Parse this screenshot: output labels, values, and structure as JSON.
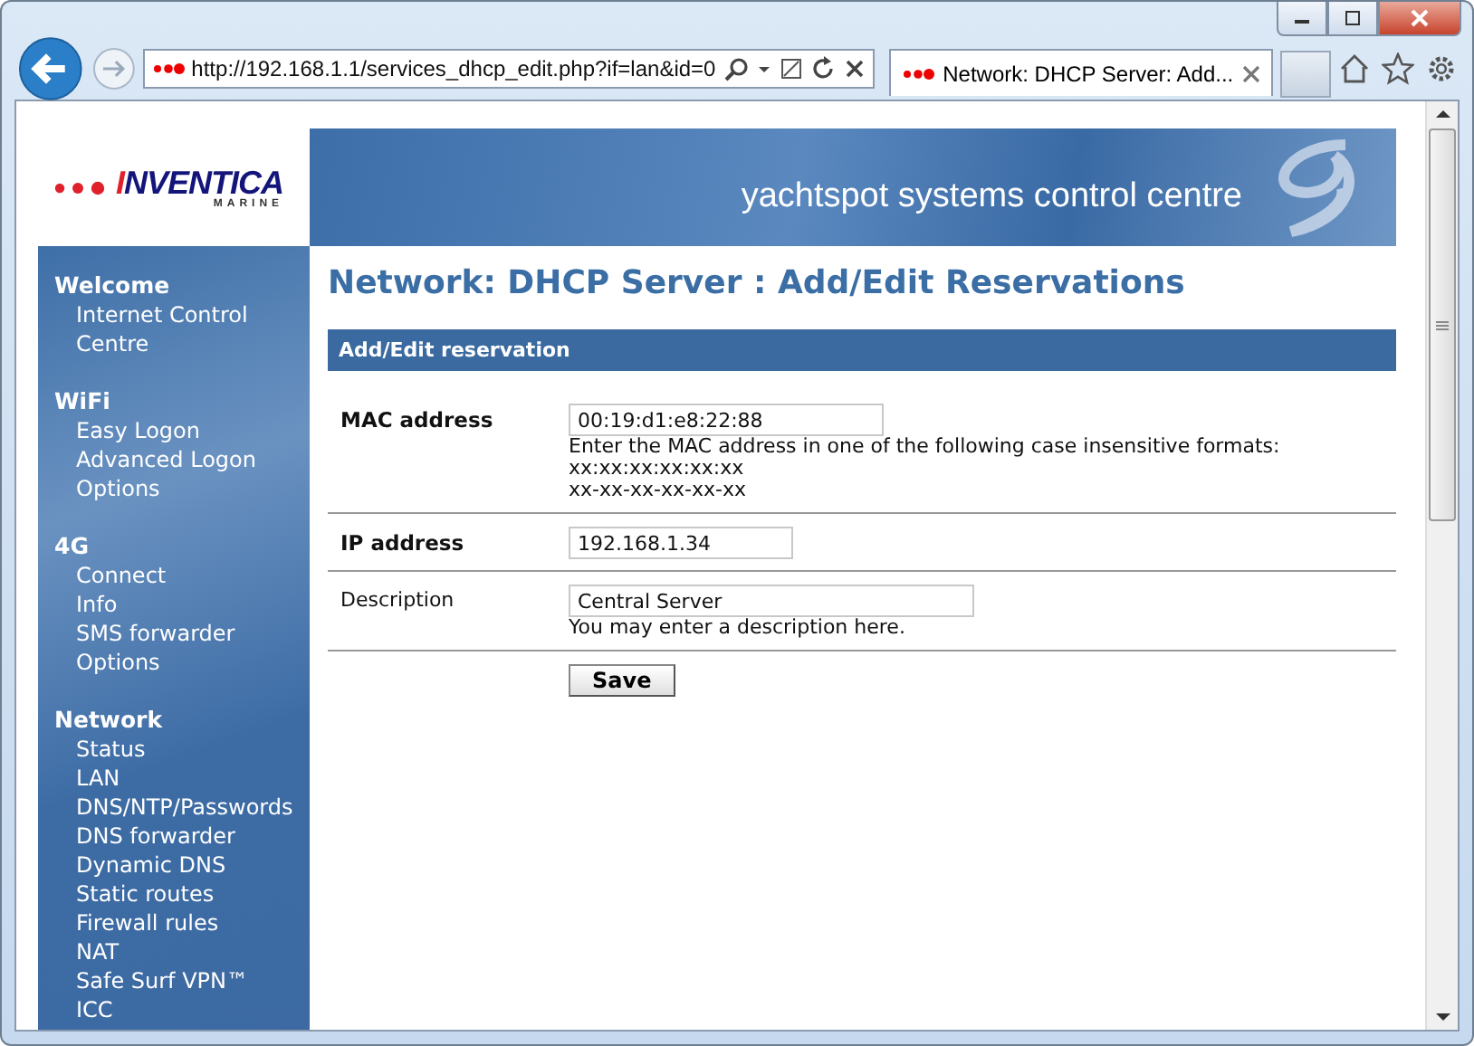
{
  "browser": {
    "url": "http://192.168.1.1/services_dhcp_edit.php?if=lan&id=0",
    "tab_title": "Network: DHCP Server: Add..."
  },
  "logo": {
    "brand": "INVENTICA",
    "sub": "MARINE"
  },
  "banner": {
    "title": "yachtspot systems control centre"
  },
  "sidebar": {
    "groups": [
      {
        "title": "Welcome",
        "items": [
          "Internet Control Centre"
        ]
      },
      {
        "title": "WiFi",
        "items": [
          "Easy Logon",
          "Advanced Logon",
          "Options"
        ]
      },
      {
        "title": "4G",
        "items": [
          "Connect",
          "Info",
          "SMS forwarder",
          "Options"
        ]
      },
      {
        "title": "Network",
        "items": [
          "Status",
          "LAN",
          "DNS/NTP/Passwords",
          "DNS forwarder",
          "Dynamic DNS",
          "Static routes",
          "Firewall rules",
          "NAT",
          "Safe Surf VPN™",
          "ICC"
        ]
      }
    ]
  },
  "page_title": "Network: DHCP Server : Add/Edit Reservations",
  "form": {
    "title": "Add/Edit reservation",
    "rows": [
      {
        "label": "MAC address",
        "required": true,
        "value": "00:19:d1:e8:22:88",
        "help": [
          "Enter the MAC address in one of the following case insensitive formats:",
          "xx:xx:xx:xx:xx:xx",
          "xx-xx-xx-xx-xx-xx"
        ]
      },
      {
        "label": "IP address",
        "required": true,
        "value": "192.168.1.34",
        "help": []
      },
      {
        "label": "Description",
        "required": false,
        "value": "Central Server",
        "help": [
          "You may enter a description here."
        ]
      }
    ],
    "submit": "Save"
  }
}
